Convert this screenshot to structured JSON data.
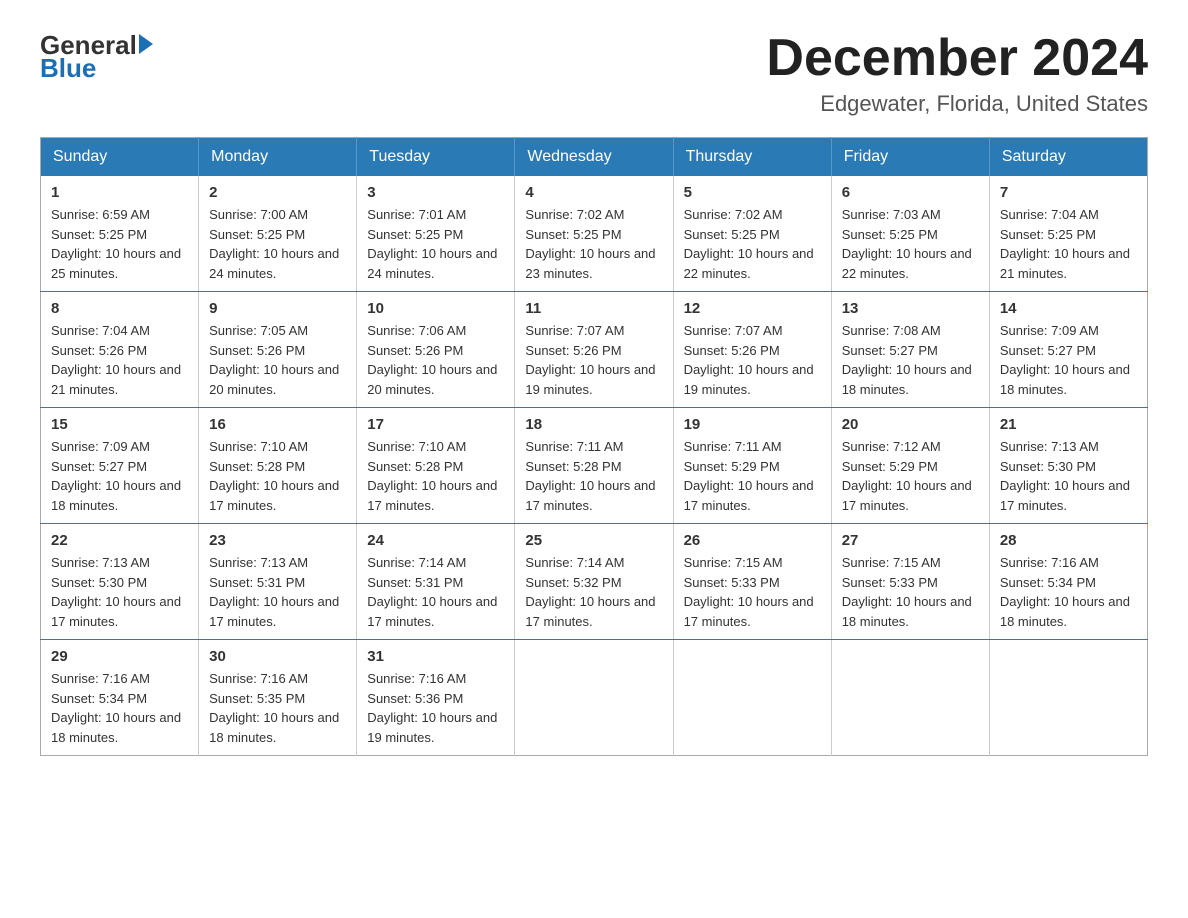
{
  "logo": {
    "general": "General",
    "blue": "Blue",
    "line2": "Blue"
  },
  "header": {
    "month_year": "December 2024",
    "location": "Edgewater, Florida, United States"
  },
  "weekdays": [
    "Sunday",
    "Monday",
    "Tuesday",
    "Wednesday",
    "Thursday",
    "Friday",
    "Saturday"
  ],
  "weeks": [
    [
      {
        "day": "1",
        "sunrise": "6:59 AM",
        "sunset": "5:25 PM",
        "daylight": "10 hours and 25 minutes."
      },
      {
        "day": "2",
        "sunrise": "7:00 AM",
        "sunset": "5:25 PM",
        "daylight": "10 hours and 24 minutes."
      },
      {
        "day": "3",
        "sunrise": "7:01 AM",
        "sunset": "5:25 PM",
        "daylight": "10 hours and 24 minutes."
      },
      {
        "day": "4",
        "sunrise": "7:02 AM",
        "sunset": "5:25 PM",
        "daylight": "10 hours and 23 minutes."
      },
      {
        "day": "5",
        "sunrise": "7:02 AM",
        "sunset": "5:25 PM",
        "daylight": "10 hours and 22 minutes."
      },
      {
        "day": "6",
        "sunrise": "7:03 AM",
        "sunset": "5:25 PM",
        "daylight": "10 hours and 22 minutes."
      },
      {
        "day": "7",
        "sunrise": "7:04 AM",
        "sunset": "5:25 PM",
        "daylight": "10 hours and 21 minutes."
      }
    ],
    [
      {
        "day": "8",
        "sunrise": "7:04 AM",
        "sunset": "5:26 PM",
        "daylight": "10 hours and 21 minutes."
      },
      {
        "day": "9",
        "sunrise": "7:05 AM",
        "sunset": "5:26 PM",
        "daylight": "10 hours and 20 minutes."
      },
      {
        "day": "10",
        "sunrise": "7:06 AM",
        "sunset": "5:26 PM",
        "daylight": "10 hours and 20 minutes."
      },
      {
        "day": "11",
        "sunrise": "7:07 AM",
        "sunset": "5:26 PM",
        "daylight": "10 hours and 19 minutes."
      },
      {
        "day": "12",
        "sunrise": "7:07 AM",
        "sunset": "5:26 PM",
        "daylight": "10 hours and 19 minutes."
      },
      {
        "day": "13",
        "sunrise": "7:08 AM",
        "sunset": "5:27 PM",
        "daylight": "10 hours and 18 minutes."
      },
      {
        "day": "14",
        "sunrise": "7:09 AM",
        "sunset": "5:27 PM",
        "daylight": "10 hours and 18 minutes."
      }
    ],
    [
      {
        "day": "15",
        "sunrise": "7:09 AM",
        "sunset": "5:27 PM",
        "daylight": "10 hours and 18 minutes."
      },
      {
        "day": "16",
        "sunrise": "7:10 AM",
        "sunset": "5:28 PM",
        "daylight": "10 hours and 17 minutes."
      },
      {
        "day": "17",
        "sunrise": "7:10 AM",
        "sunset": "5:28 PM",
        "daylight": "10 hours and 17 minutes."
      },
      {
        "day": "18",
        "sunrise": "7:11 AM",
        "sunset": "5:28 PM",
        "daylight": "10 hours and 17 minutes."
      },
      {
        "day": "19",
        "sunrise": "7:11 AM",
        "sunset": "5:29 PM",
        "daylight": "10 hours and 17 minutes."
      },
      {
        "day": "20",
        "sunrise": "7:12 AM",
        "sunset": "5:29 PM",
        "daylight": "10 hours and 17 minutes."
      },
      {
        "day": "21",
        "sunrise": "7:13 AM",
        "sunset": "5:30 PM",
        "daylight": "10 hours and 17 minutes."
      }
    ],
    [
      {
        "day": "22",
        "sunrise": "7:13 AM",
        "sunset": "5:30 PM",
        "daylight": "10 hours and 17 minutes."
      },
      {
        "day": "23",
        "sunrise": "7:13 AM",
        "sunset": "5:31 PM",
        "daylight": "10 hours and 17 minutes."
      },
      {
        "day": "24",
        "sunrise": "7:14 AM",
        "sunset": "5:31 PM",
        "daylight": "10 hours and 17 minutes."
      },
      {
        "day": "25",
        "sunrise": "7:14 AM",
        "sunset": "5:32 PM",
        "daylight": "10 hours and 17 minutes."
      },
      {
        "day": "26",
        "sunrise": "7:15 AM",
        "sunset": "5:33 PM",
        "daylight": "10 hours and 17 minutes."
      },
      {
        "day": "27",
        "sunrise": "7:15 AM",
        "sunset": "5:33 PM",
        "daylight": "10 hours and 18 minutes."
      },
      {
        "day": "28",
        "sunrise": "7:16 AM",
        "sunset": "5:34 PM",
        "daylight": "10 hours and 18 minutes."
      }
    ],
    [
      {
        "day": "29",
        "sunrise": "7:16 AM",
        "sunset": "5:34 PM",
        "daylight": "10 hours and 18 minutes."
      },
      {
        "day": "30",
        "sunrise": "7:16 AM",
        "sunset": "5:35 PM",
        "daylight": "10 hours and 18 minutes."
      },
      {
        "day": "31",
        "sunrise": "7:16 AM",
        "sunset": "5:36 PM",
        "daylight": "10 hours and 19 minutes."
      },
      null,
      null,
      null,
      null
    ]
  ]
}
